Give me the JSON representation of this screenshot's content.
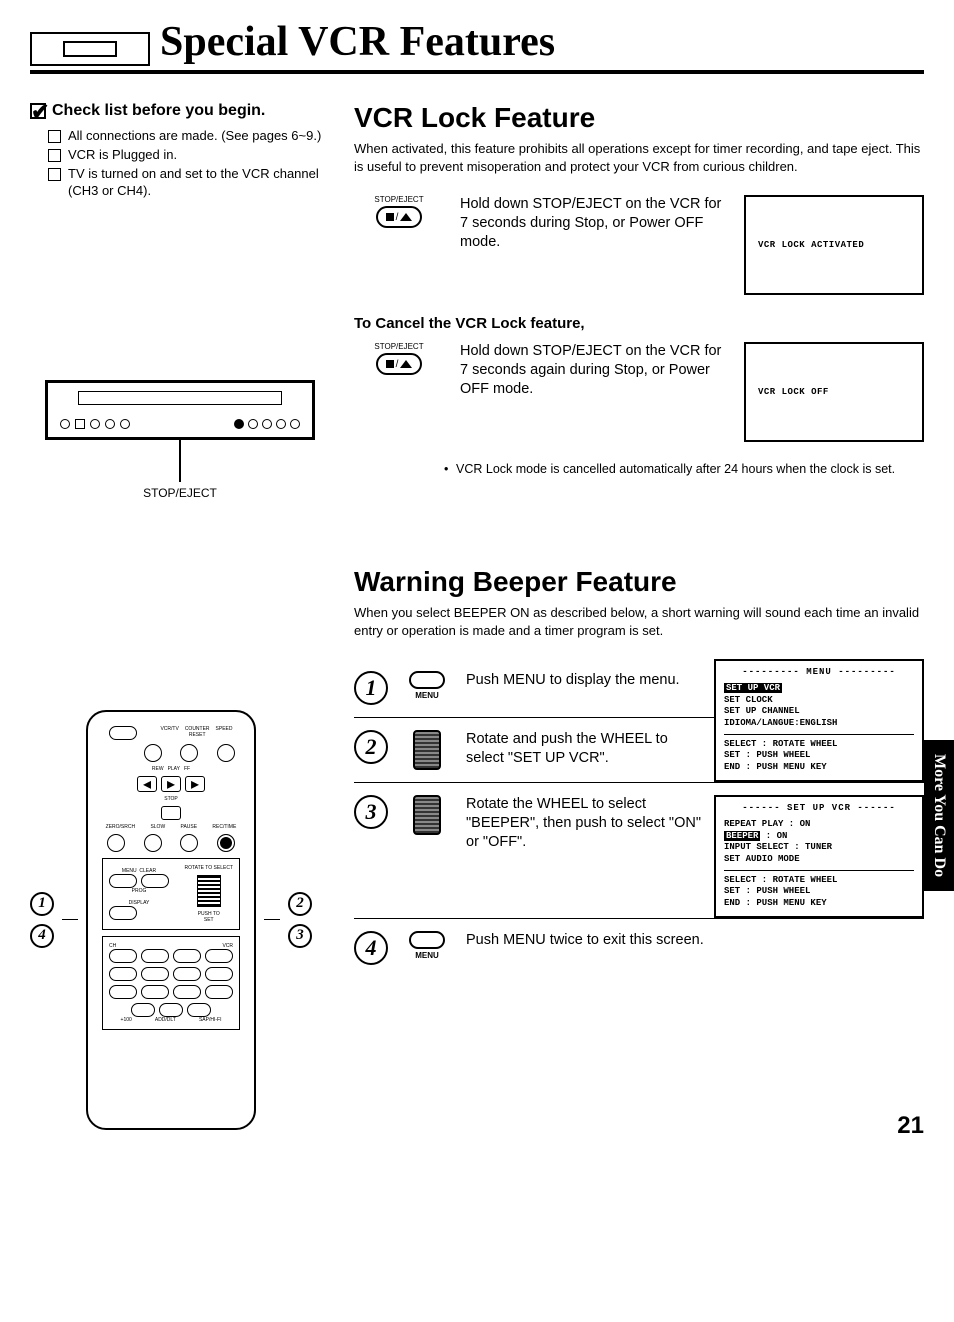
{
  "header": {
    "title": "Special VCR Features"
  },
  "checklist": {
    "heading": "Check list before you begin.",
    "items": [
      "All connections are made. (See pages 6~9.)",
      "VCR is Plugged in.",
      "TV is turned on and set to the VCR channel (CH3 or CH4)."
    ]
  },
  "vcr_unit_label": "STOP/EJECT",
  "lock_feature": {
    "heading": "VCR Lock Feature",
    "intro": "When activated, this feature prohibits all operations except for timer recording, and tape eject. This is useful to prevent misoperation and protect your VCR from curious children.",
    "btn_label": "STOP/EJECT",
    "activate_text": "Hold down STOP/EJECT on the VCR for 7 seconds during Stop, or Power OFF mode.",
    "activate_display": "VCR LOCK ACTIVATED",
    "cancel_heading": "To Cancel the VCR Lock feature,",
    "cancel_text": "Hold down STOP/EJECT on the VCR for 7 seconds again during Stop, or Power OFF mode.",
    "cancel_display": "VCR LOCK OFF",
    "note": "VCR Lock mode is cancelled automatically after 24 hours when the clock is set."
  },
  "beeper": {
    "heading": "Warning Beeper Feature",
    "intro": "When you select BEEPER ON as described below, a short warning will sound each time an invalid entry or operation is made and a timer program is set.",
    "steps": [
      {
        "num": "1",
        "ctrl": "menu",
        "ctrl_label": "MENU",
        "text": "Push MENU to display the menu."
      },
      {
        "num": "2",
        "ctrl": "wheel",
        "text": "Rotate and push the WHEEL to select \"SET UP VCR\"."
      },
      {
        "num": "3",
        "ctrl": "wheel",
        "text": "Rotate the WHEEL to select \"BEEPER\", then push to select \"ON\" or \"OFF\"."
      },
      {
        "num": "4",
        "ctrl": "menu",
        "ctrl_label": "MENU",
        "text": "Push MENU twice to exit this screen."
      }
    ],
    "osd_menu": {
      "title": "--------- MENU ---------",
      "items": [
        "SET UP VCR",
        "SET CLOCK",
        "SET UP CHANNEL",
        "IDIOMA/LANGUE:ENGLISH"
      ],
      "highlighted": 0,
      "footer": [
        "SELECT : ROTATE WHEEL",
        "SET    : PUSH WHEEL",
        "END    : PUSH MENU KEY"
      ]
    },
    "osd_setup": {
      "title": "------ SET UP VCR ------",
      "items": [
        "REPEAT PLAY  : ON",
        "BEEPER       : ON",
        "INPUT SELECT : TUNER",
        "SET AUDIO MODE"
      ],
      "highlighted": 1,
      "footer": [
        "SELECT : ROTATE WHEEL",
        "SET    : PUSH WHEEL",
        "END    : PUSH MENU KEY"
      ]
    }
  },
  "side_tab": "More You Can Do",
  "page_number": "21"
}
